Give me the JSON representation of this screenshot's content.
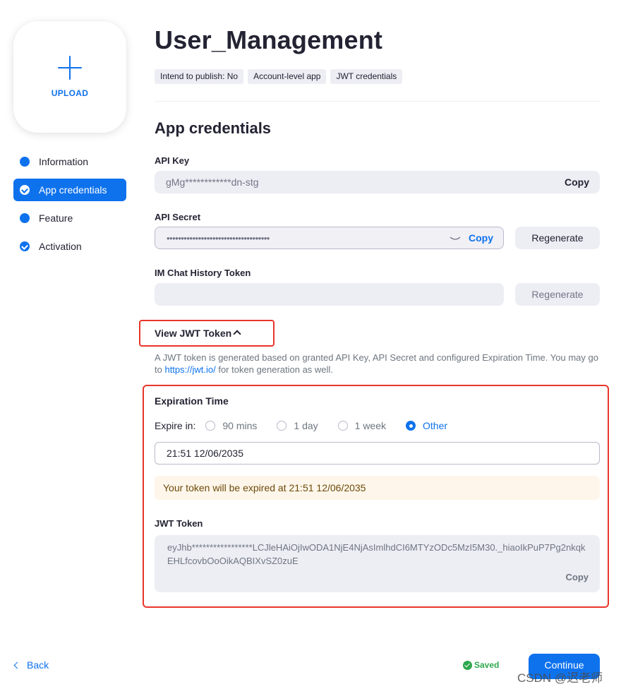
{
  "upload": {
    "label": "UPLOAD"
  },
  "nav": {
    "items": [
      {
        "label": "Information",
        "state": "dot"
      },
      {
        "label": "App credentials",
        "state": "check-active"
      },
      {
        "label": "Feature",
        "state": "dot"
      },
      {
        "label": "Activation",
        "state": "check"
      }
    ]
  },
  "header": {
    "title": "User_Management",
    "tags": [
      "Intend to publish: No",
      "Account-level app",
      "JWT credentials"
    ]
  },
  "section_title": "App credentials",
  "api_key": {
    "label": "API Key",
    "value": "gMg************dn-stg",
    "copy": "Copy"
  },
  "api_secret": {
    "label": "API Secret",
    "value": "••••••••••••••••••••••••••••••••••••",
    "copy": "Copy",
    "regenerate": "Regenerate"
  },
  "im_chat": {
    "label": "IM Chat History Token",
    "value": "",
    "regenerate": "Regenerate"
  },
  "jwt": {
    "toggle_label": "View JWT Token",
    "desc_before": "A JWT token is generated based on granted API Key, API Secret and configured Expiration Time. You may go to ",
    "desc_link": "https://jwt.io/",
    "desc_after": " for token generation as well.",
    "expiration_title": "Expiration Time",
    "expire_in_label": "Expire in:",
    "options": [
      "90 mins",
      "1 day",
      "1 week",
      "Other"
    ],
    "selected_option": "Other",
    "date_value": "21:51 12/06/2035",
    "warning": "Your token will be expired at 21:51 12/06/2035",
    "token_label": "JWT Token",
    "token_value": "eyJhb*****************LCJleHAiOjIwODA1NjE4NjAsImlhdCI6MTYzODc5MzI5M30._hiaoIkPuP7Pg2nkqkEHLfcovbOoOikAQBIXvSZ0zuE",
    "token_copy": "Copy"
  },
  "footer": {
    "back": "Back",
    "saved": "Saved",
    "continue": "Continue",
    "watermark": "CSDN @迟老师"
  },
  "colors": {
    "accent": "#0e72ed",
    "highlight_border": "#e8352a",
    "saved": "#2ea84d"
  }
}
